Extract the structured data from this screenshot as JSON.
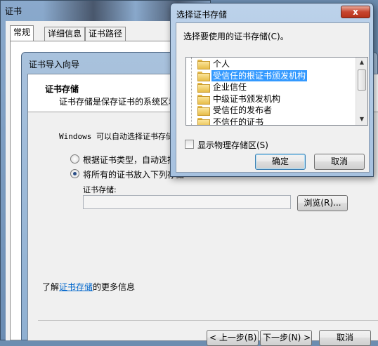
{
  "cert_window": {
    "title": "证书",
    "tabs": [
      "常规",
      "详细信息",
      "证书路径"
    ]
  },
  "wizard": {
    "title": "证书导入向导",
    "header_title": "证书存储",
    "header_desc": "证书存储是保存证书的系统区域",
    "auto_text": "Windows 可以自动选择证书存储",
    "radio_auto": "根据证书类型，自动选择证书存储",
    "radio_manual": "将所有的证书放入下列存储",
    "store_label": "证书存储:",
    "store_value": "",
    "browse_label": "浏览(R)...",
    "learn_prefix": "了解",
    "learn_link": "证书存储",
    "learn_suffix": "的更多信息",
    "back_label": "< 上一步(B)",
    "next_label": "下一步(N) >",
    "cancel_label": "取消"
  },
  "select_store": {
    "title": "选择证书存储",
    "close_glyph": "x",
    "prompt": "选择要使用的证书存储(C)。",
    "stores": [
      {
        "label": "个人",
        "selected": false
      },
      {
        "label": "受信任的根证书颁发机构",
        "selected": true
      },
      {
        "label": "企业信任",
        "selected": false
      },
      {
        "label": "中级证书颁发机构",
        "selected": false
      },
      {
        "label": "受信任的发布者",
        "selected": false
      },
      {
        "label": "不信任的证书",
        "selected": false
      }
    ],
    "show_physical_label": "显示物理存储区(S)",
    "show_physical_checked": false,
    "ok_label": "确定",
    "cancel_label": "取消"
  }
}
